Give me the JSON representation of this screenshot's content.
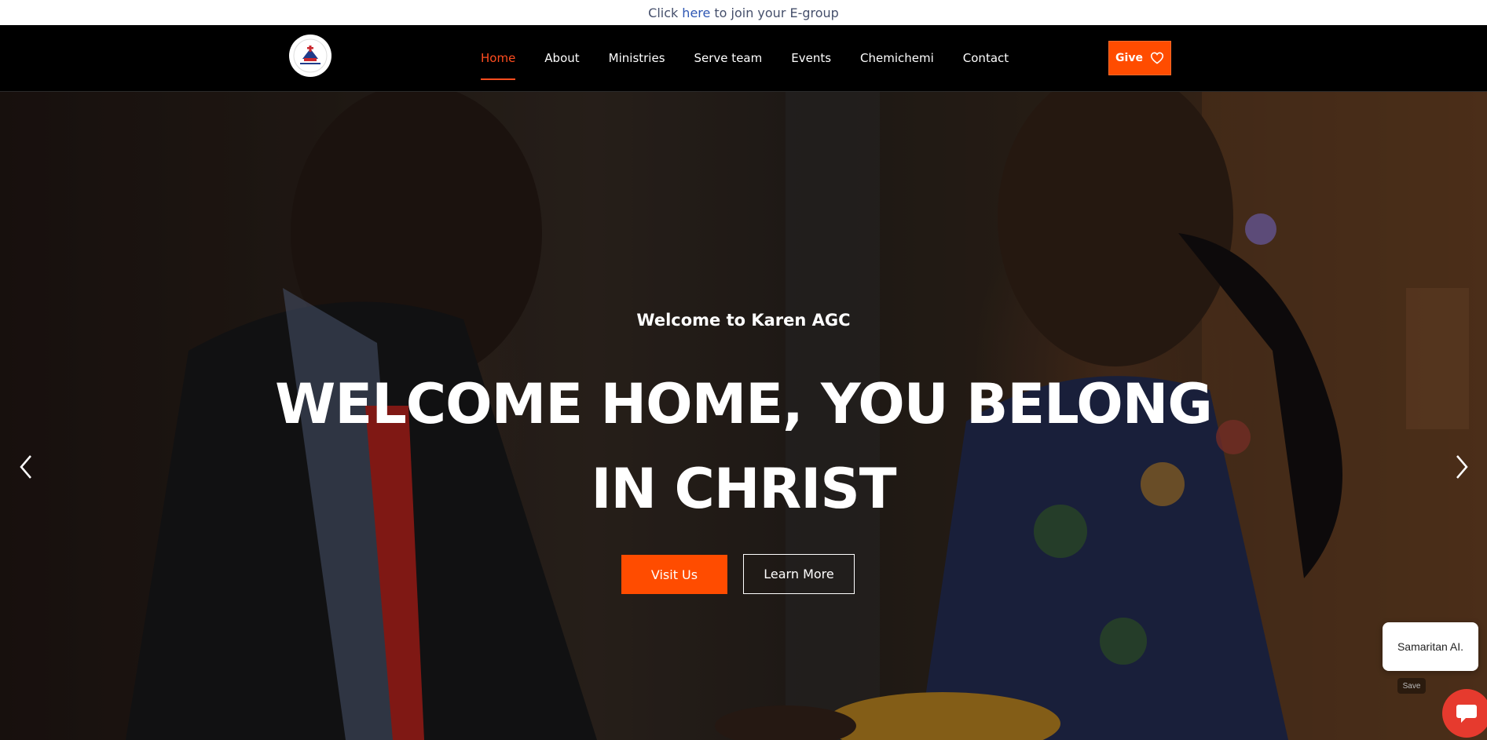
{
  "topbar": {
    "prefix": "Click",
    "link": "here",
    "suffix": "to join your E-group"
  },
  "nav": {
    "items": [
      {
        "label": "Home",
        "active": true
      },
      {
        "label": "About"
      },
      {
        "label": "Ministries"
      },
      {
        "label": "Serve team"
      },
      {
        "label": "Events"
      },
      {
        "label": "Chemichemi"
      },
      {
        "label": "Contact"
      }
    ],
    "give_label": "Give",
    "accent": "#ff4c00"
  },
  "hero": {
    "subtitle": "Welcome to Karen AGC",
    "title_line1": "WELCOME HOME, YOU BELONG",
    "title_line2": "IN CHRIST",
    "visit_label": "Visit Us",
    "learn_label": "Learn More"
  },
  "chat": {
    "bubble_text": "Samaritan AI.",
    "save_label": "Save"
  },
  "icons": {
    "give": "heart-icon",
    "prev": "chevron-left-icon",
    "next": "chevron-right-icon",
    "chat": "chat-icon"
  }
}
